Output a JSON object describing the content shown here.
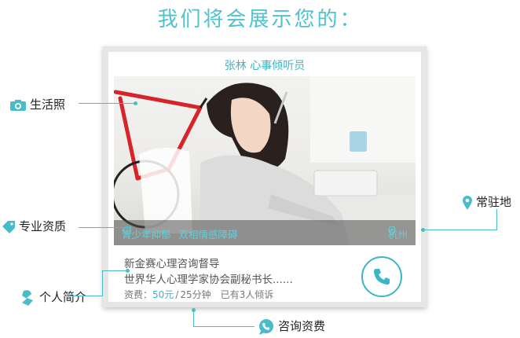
{
  "headline": "我们将会展示您的：",
  "card": {
    "name_title": "张林   心事倾听员",
    "tags": [
      "青少年抑郁",
      "双相情感障碍"
    ],
    "location": "杭州",
    "intro_line1": "新金赛心理咨询督导",
    "intro_line2": "世界华人心理学家协会副秘书长......",
    "fee_label": "资费：",
    "fee_price": "50元",
    "fee_duration": "25分钟",
    "fee_separator": "/",
    "listen_count": "已有3人倾诉"
  },
  "labels": {
    "photo": "生活照",
    "specialty": "专业资质",
    "intro": "个人简介",
    "location": "常驻地",
    "fee": "咨询资费"
  },
  "colors": {
    "accent": "#3ab6c4",
    "line": "#48bdc9",
    "headline": "#4ec3cf"
  },
  "icons": [
    "camera-icon",
    "tag-icon",
    "pin-icon",
    "person-icon",
    "chat-icon",
    "phone-icon",
    "map-pin-icon"
  ]
}
